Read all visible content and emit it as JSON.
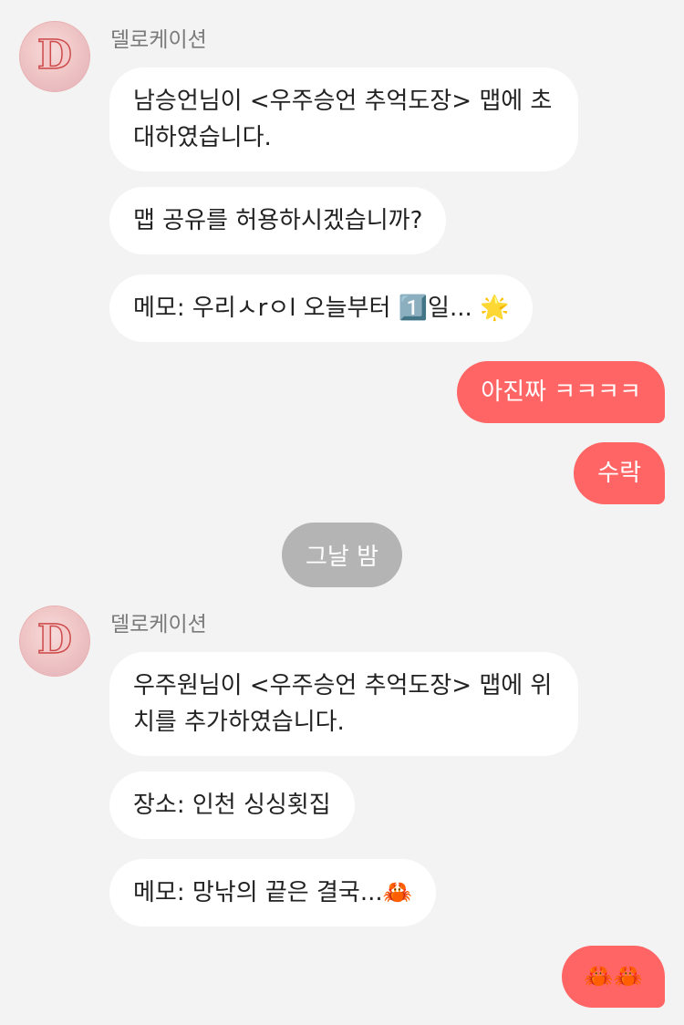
{
  "chat": {
    "group1": {
      "sender": "델로케이션",
      "avatar_letter": "D",
      "messages": [
        "남승언님이 <우주승언 추억도장> 맵에 초대하였습니다.",
        "맵 공유를 허용하시겠습니까?",
        "메모: 우리ㅅrㅇl 오늘부터 1️⃣일... 🌟"
      ]
    },
    "sent1": [
      "아진짜 ㅋㅋㅋㅋ",
      "수락"
    ],
    "date_divider": "그날 밤",
    "group2": {
      "sender": "델로케이션",
      "avatar_letter": "D",
      "messages": [
        "우주원님이 <우주승언 추억도장> 맵에 위치를 추가하였습니다.",
        "장소: 인천 싱싱횟집",
        "메모: 망낚의 끝은 결국...🦀"
      ]
    },
    "sent2": [
      "🦀🦀"
    ]
  },
  "colors": {
    "background": "#f3f3f3",
    "incoming_bubble": "#ffffff",
    "outgoing_bubble": "#ff6564",
    "date_pill": "#b4b4b4",
    "sender_text": "#7a7a7a"
  }
}
